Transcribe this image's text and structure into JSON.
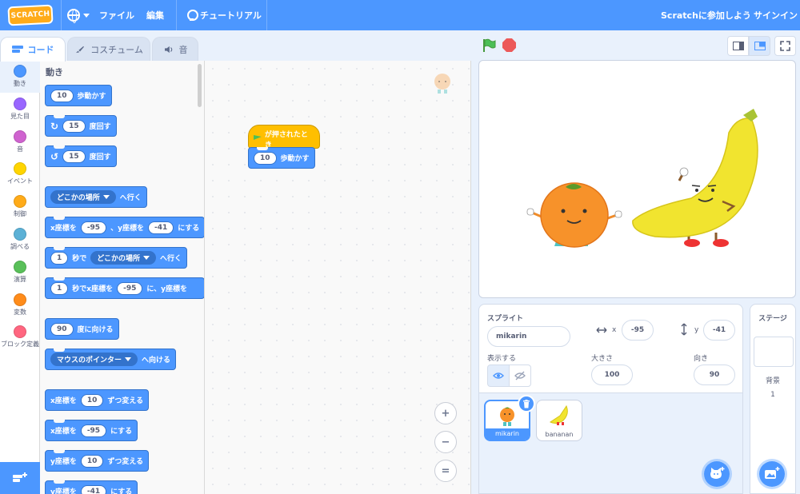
{
  "menubar": {
    "logo_text": "SCRATCH",
    "file": "ファイル",
    "edit": "編集",
    "tutorials": "チュートリアル",
    "join": "Scratchに参加しよう",
    "signin": "サインイン"
  },
  "tabs": {
    "code": "コード",
    "costumes": "コスチューム",
    "sounds": "音"
  },
  "categories": [
    {
      "label": "動き",
      "color": "#4c97ff"
    },
    {
      "label": "見た目",
      "color": "#9966ff"
    },
    {
      "label": "音",
      "color": "#cf63cf"
    },
    {
      "label": "イベント",
      "color": "#ffd500"
    },
    {
      "label": "制御",
      "color": "#ffab19"
    },
    {
      "label": "調べる",
      "color": "#5cb1d6"
    },
    {
      "label": "演算",
      "color": "#59c059"
    },
    {
      "label": "変数",
      "color": "#ff8c1a"
    },
    {
      "label": "ブロック定義",
      "color": "#ff6680"
    }
  ],
  "palette": {
    "title": "動き",
    "move": {
      "value": "10",
      "text": "歩動かす"
    },
    "turn_right": {
      "value": "15",
      "text": "度回す"
    },
    "turn_left": {
      "value": "15",
      "text": "度回す"
    },
    "goto": {
      "dropdown": "どこかの場所",
      "text": "へ行く"
    },
    "gotoxy": {
      "t1": "x座標を",
      "x": "-95",
      "t2": "、y座標を",
      "y": "-41",
      "t3": "にする"
    },
    "glide": {
      "secs": "1",
      "t1": "秒で",
      "dropdown": "どこかの場所",
      "t2": "へ行く"
    },
    "glidexy": {
      "secs": "1",
      "t1": "秒でx座標を",
      "x": "-95",
      "t2": "に、y座標を"
    },
    "point_dir": {
      "value": "90",
      "text": "度に向ける"
    },
    "point_towards": {
      "dropdown": "マウスのポインター",
      "text": "へ向ける"
    },
    "change_x": {
      "t1": "x座標を",
      "value": "10",
      "t2": "ずつ変える"
    },
    "set_x": {
      "t1": "x座標を",
      "value": "-95",
      "t2": "にする"
    },
    "change_y": {
      "t1": "y座標を",
      "value": "10",
      "t2": "ずつ変える"
    },
    "set_y": {
      "t1": "y座標を",
      "value": "-41",
      "t2": "にする"
    }
  },
  "script": {
    "hat_text": "が押されたとき",
    "move_value": "10",
    "move_text": "歩動かす"
  },
  "zoom": {
    "in": "+",
    "out": "−",
    "reset": "="
  },
  "sprite_info": {
    "label": "スプライト",
    "name": "mikarin",
    "x_label": "x",
    "x": "-95",
    "y_label": "y",
    "y": "-41",
    "show_label": "表示する",
    "size_label": "大きさ",
    "size": "100",
    "direction_label": "向き",
    "direction": "90"
  },
  "sprites": [
    {
      "name": "mikarin",
      "selected": true
    },
    {
      "name": "bananan",
      "selected": false
    }
  ],
  "stage_panel": {
    "title": "ステージ",
    "backdrops_label": "背景",
    "backdrops_count": "1"
  }
}
